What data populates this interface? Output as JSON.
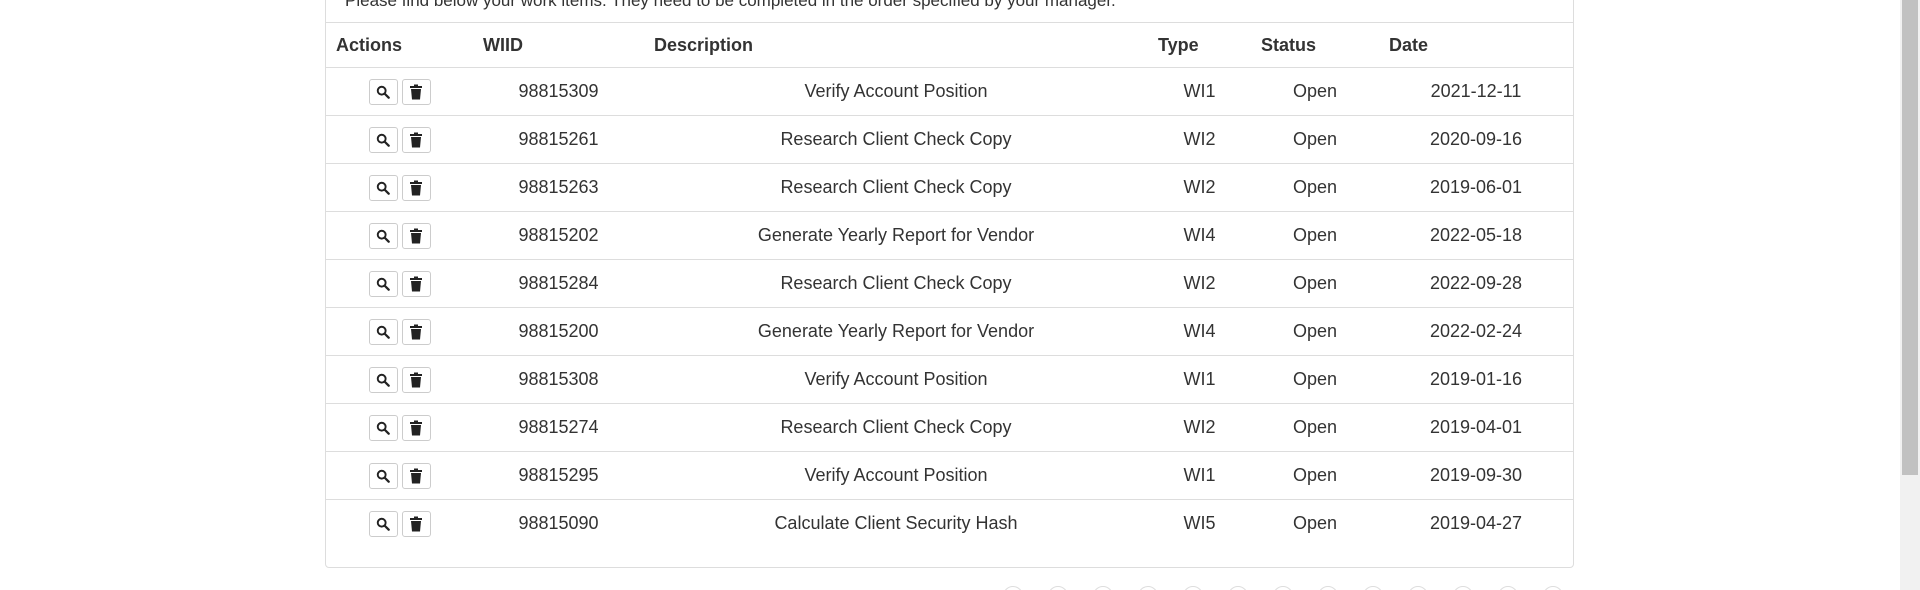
{
  "intro_text": "Please find below your work items. They need to be completed in the order specified by your manager.",
  "table": {
    "headers": {
      "actions": "Actions",
      "wiid": "WIID",
      "description": "Description",
      "type": "Type",
      "status": "Status",
      "date": "Date"
    },
    "rows": [
      {
        "wiid": "98815309",
        "description": "Verify Account Position",
        "type": "WI1",
        "status": "Open",
        "date": "2021-12-11"
      },
      {
        "wiid": "98815261",
        "description": "Research Client Check Copy",
        "type": "WI2",
        "status": "Open",
        "date": "2020-09-16"
      },
      {
        "wiid": "98815263",
        "description": "Research Client Check Copy",
        "type": "WI2",
        "status": "Open",
        "date": "2019-06-01"
      },
      {
        "wiid": "98815202",
        "description": "Generate Yearly Report for Vendor",
        "type": "WI4",
        "status": "Open",
        "date": "2022-05-18"
      },
      {
        "wiid": "98815284",
        "description": "Research Client Check Copy",
        "type": "WI2",
        "status": "Open",
        "date": "2022-09-28"
      },
      {
        "wiid": "98815200",
        "description": "Generate Yearly Report for Vendor",
        "type": "WI4",
        "status": "Open",
        "date": "2022-02-24"
      },
      {
        "wiid": "98815308",
        "description": "Verify Account Position",
        "type": "WI1",
        "status": "Open",
        "date": "2019-01-16"
      },
      {
        "wiid": "98815274",
        "description": "Research Client Check Copy",
        "type": "WI2",
        "status": "Open",
        "date": "2019-04-01"
      },
      {
        "wiid": "98815295",
        "description": "Verify Account Position",
        "type": "WI1",
        "status": "Open",
        "date": "2019-09-30"
      },
      {
        "wiid": "98815090",
        "description": "Calculate Client Security Hash",
        "type": "WI5",
        "status": "Open",
        "date": "2019-04-27"
      }
    ]
  },
  "icons": {
    "view": "search-icon",
    "delete": "trash-icon"
  },
  "colors": {
    "text": "#333333",
    "border": "#dddddd",
    "scrollbar_thumb": "#c1c1c1"
  }
}
